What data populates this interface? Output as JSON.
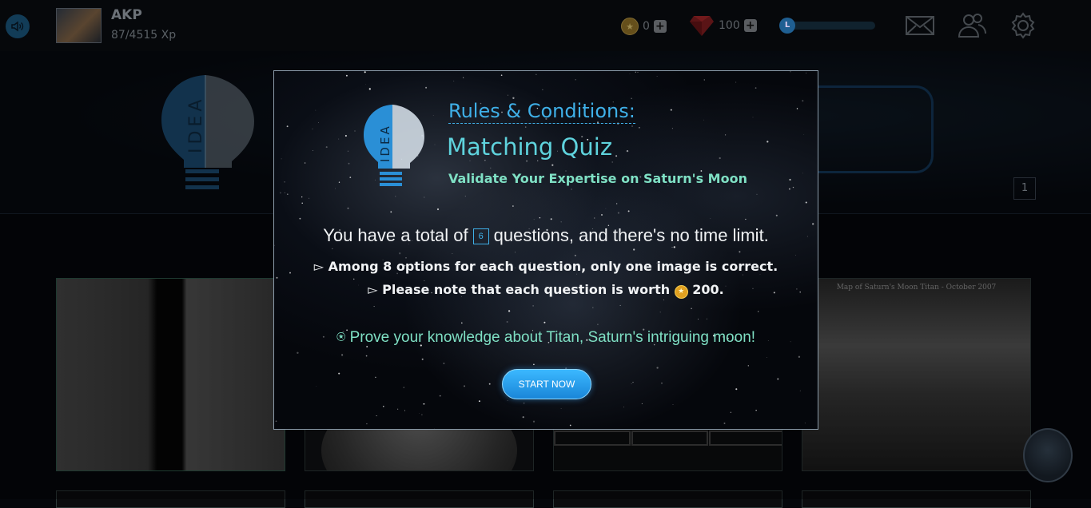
{
  "header": {
    "user_name": "AKP",
    "xp": "87/4515 Xp",
    "coins": "0",
    "gems": "100",
    "level_badge": "L",
    "level_progress": 0.02
  },
  "hero": {
    "bulb_text": "IDEA",
    "page_number": "1"
  },
  "cards": [
    {
      "caption": ""
    },
    {
      "caption": ""
    },
    {
      "caption": ""
    },
    {
      "caption": "Map of Saturn's Moon Titan - October 2007"
    }
  ],
  "modal": {
    "bulb_text": "IDEA",
    "rules_title": "Rules & Conditions:",
    "quiz_title": "Matching Quiz",
    "quiz_subtitle": "Validate Your Expertise on Saturn's Moon",
    "total_prefix": "You have a total of",
    "question_count": "6",
    "total_suffix": "questions, and there's no time limit.",
    "rule_1": "▻ Among 8 options for each question, only one image is correct.",
    "rule_2_prefix": "▻ Please note that each question is worth",
    "rule_2_value": "200.",
    "prove_text": "⍟ Prove your knowledge about Titan, Saturn's intriguing moon!",
    "start_label": "START NOW"
  },
  "colors": {
    "accent_blue": "#3fb0e8",
    "accent_teal": "#7fe0c4",
    "background": "#05070b"
  }
}
